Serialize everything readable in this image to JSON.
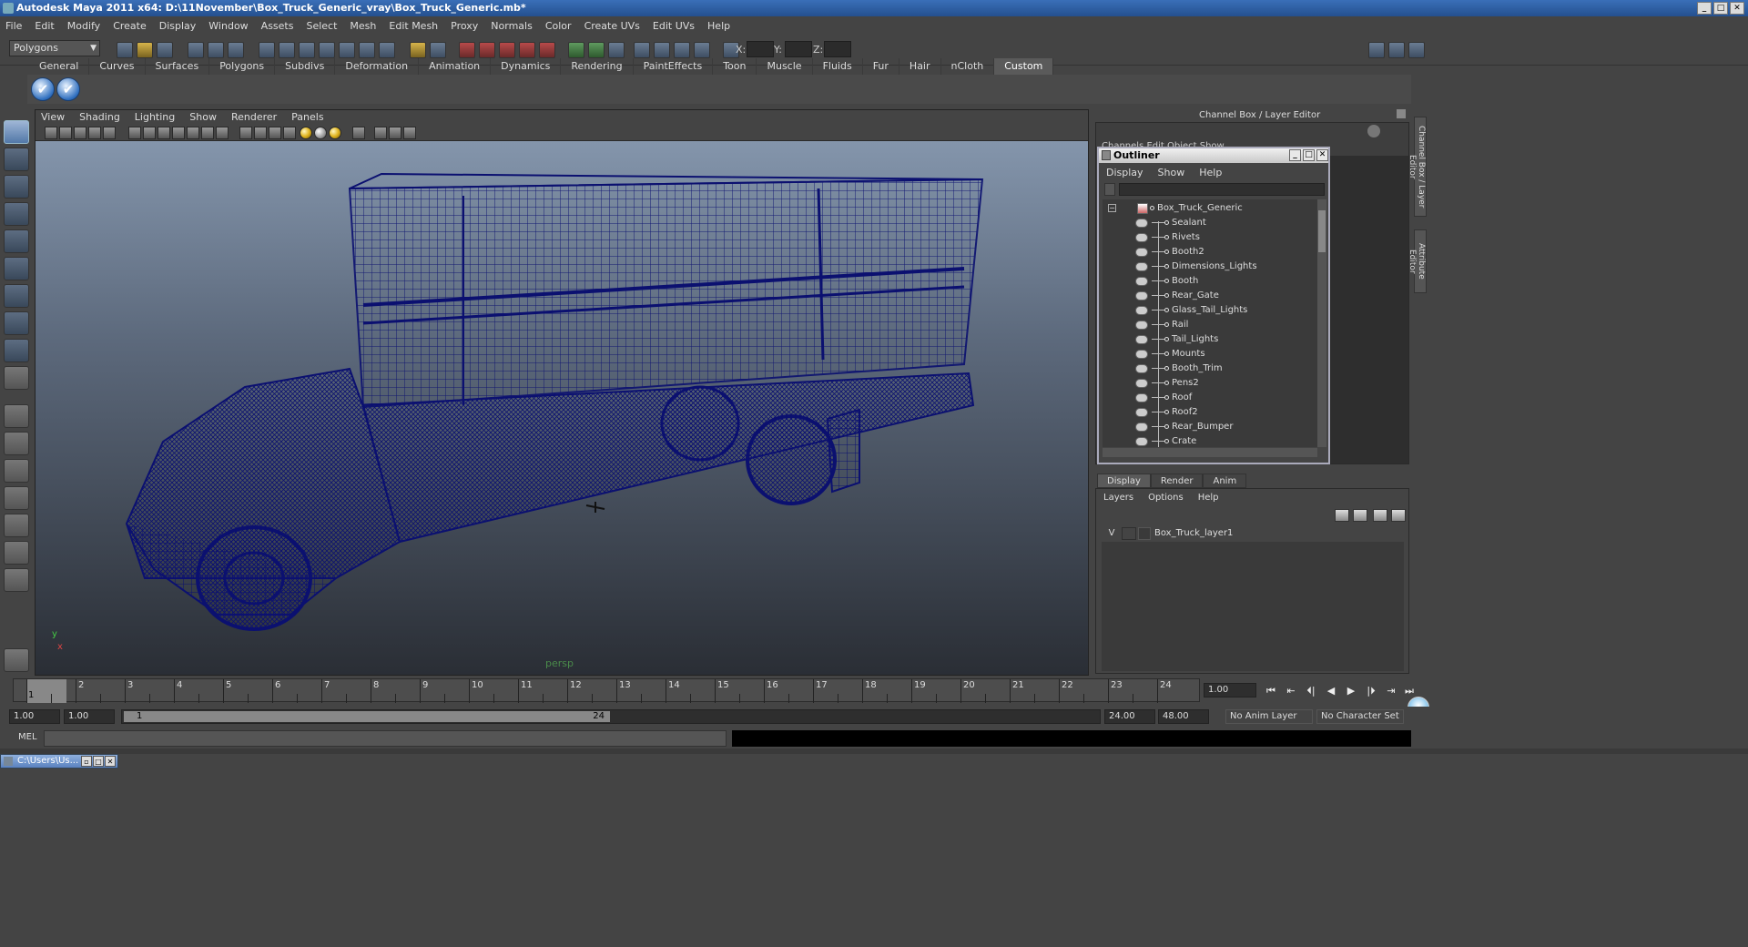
{
  "window": {
    "title": "Autodesk Maya 2011 x64: D:\\11November\\Box_Truck_Generic_vray\\Box_Truck_Generic.mb*",
    "buttons": [
      "_",
      "□",
      "✕"
    ]
  },
  "menubar": [
    "File",
    "Edit",
    "Modify",
    "Create",
    "Display",
    "Window",
    "Assets",
    "Select",
    "Mesh",
    "Edit Mesh",
    "Proxy",
    "Normals",
    "Color",
    "Create UVs",
    "Edit UVs",
    "Help"
  ],
  "statusline": {
    "mode": "Polygons",
    "x_label": "X:",
    "y_label": "Y:",
    "z_label": "Z:"
  },
  "shelf": {
    "tabs": [
      "General",
      "Curves",
      "Surfaces",
      "Polygons",
      "Subdivs",
      "Deformation",
      "Animation",
      "Dynamics",
      "Rendering",
      "PaintEffects",
      "Toon",
      "Muscle",
      "Fluids",
      "Fur",
      "Hair",
      "nCloth",
      "Custom"
    ],
    "active_tab": "Custom",
    "buttons": [
      "✔",
      "✔"
    ]
  },
  "viewport": {
    "menu": [
      "View",
      "Shading",
      "Lighting",
      "Show",
      "Renderer",
      "Panels"
    ],
    "camera": "persp",
    "axis_y": "y",
    "axis_x": "x",
    "wire_color": "#0b1070"
  },
  "channel_box": {
    "header": "Channel Box / Layer Editor",
    "menu": "Channels   Edit   Object   Show",
    "side_tabs": [
      "Channel Box / Layer Editor",
      "Attribute Editor"
    ]
  },
  "outliner": {
    "title": "Outliner",
    "menu": [
      "Display",
      "Show",
      "Help"
    ],
    "root": "Box_Truck_Generic",
    "expand": "−",
    "items": [
      "Sealant",
      "Rivets",
      "Booth2",
      "Dimensions_Lights",
      "Booth",
      "Rear_Gate",
      "Glass_Tail_Lights",
      "Rail",
      "Tail_Lights",
      "Mounts",
      "Booth_Trim",
      "Pens2",
      "Roof",
      "Roof2",
      "Rear_Bumper",
      "Crate"
    ]
  },
  "layer_editor": {
    "tabs": [
      "Display",
      "Render",
      "Anim"
    ],
    "active_tab": "Display",
    "menu": [
      "Layers",
      "Options",
      "Help"
    ],
    "layers": [
      {
        "visible": "V",
        "name": "Box_Truck_layer1"
      }
    ]
  },
  "timeline": {
    "ticks": [
      1,
      2,
      3,
      4,
      5,
      6,
      7,
      8,
      9,
      10,
      11,
      12,
      13,
      14,
      15,
      16,
      17,
      18,
      19,
      20,
      21,
      22,
      23,
      24
    ],
    "current_frame": "1",
    "current_field": "1.00",
    "playback_buttons": [
      "⏮",
      "⇤",
      "⏴|",
      "◀",
      "▶",
      "|⏵",
      "⇥",
      "⏭"
    ]
  },
  "range": {
    "start": "1.00",
    "playback_start": "1.00",
    "handle_start": "1",
    "handle_end": "24",
    "playback_end": "24.00",
    "end": "48.00",
    "anim_layer": "No Anim Layer",
    "character_set": "No Character Set"
  },
  "command_line": {
    "label": "MEL"
  },
  "taskbar": {
    "minimized_window": "C:\\Users\\Us..."
  }
}
